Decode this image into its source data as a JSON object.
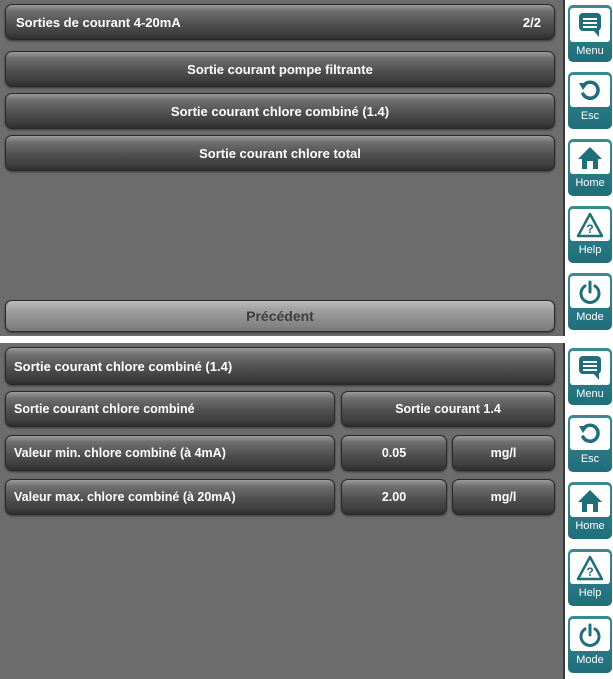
{
  "screen1": {
    "title": "Sorties de courant 4-20mA",
    "page": "2/2",
    "buttons": [
      "Sortie courant pompe filtrante",
      "Sortie courant chlore combiné (1.4)",
      "Sortie courant chlore total"
    ],
    "prev": "Précédent"
  },
  "screen2": {
    "title": "Sortie courant chlore combiné (1.4)",
    "rows": [
      {
        "label": "Sortie courant chlore combiné",
        "value": "Sortie courant 1.4"
      },
      {
        "label": "Valeur min. chlore combiné (à 4mA)",
        "value": "0.05",
        "unit": "mg/l"
      },
      {
        "label": "Valeur max. chlore combiné (à 20mA)",
        "value": "2.00",
        "unit": "mg/l"
      }
    ]
  },
  "sidebar": {
    "menu": "Menu",
    "esc": "Esc",
    "home": "Home",
    "help": "Help",
    "mode": "Mode",
    "accent": "#1f6e7a"
  }
}
